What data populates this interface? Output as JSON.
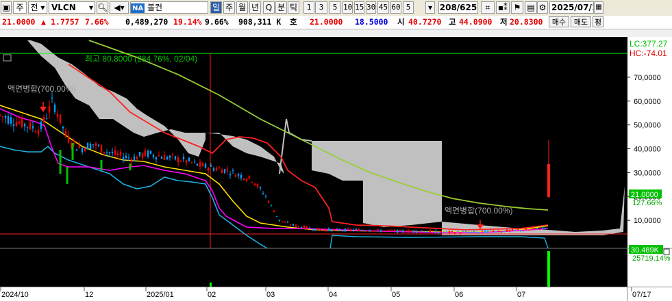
{
  "toolbar": {
    "kind_label": "주",
    "kind2_label": "전",
    "ticker": "VLCN",
    "exchange_badge": "NA",
    "company_name": "볼컨",
    "periods": [
      "일",
      "주",
      "월",
      "년",
      "Q",
      "분",
      "틱"
    ],
    "selected_period": "일",
    "intervals": [
      "1",
      "3",
      "5",
      "10",
      "15",
      "30",
      "45",
      "60",
      "5"
    ],
    "count_display": "208/625",
    "date_value": "2025/07/1"
  },
  "quote": {
    "price": "21.0000",
    "change_arrow": "▲",
    "change": "1.7757",
    "change_pct": "7.66%",
    "volume_partial": "0,489,270",
    "vol_pct": "19.14%",
    "turnover_pct": "9.66%",
    "amount": "908,311 K",
    "ho_label": "호",
    "bid": "21.0000",
    "ask": "18.5000",
    "open_label": "시",
    "open": "40.7270",
    "high_label": "고",
    "high": "44.0900",
    "low_label": "저",
    "low": "20.8300",
    "buy_button": "매수",
    "sell_button": "매도",
    "eval_button": "평"
  },
  "overlay": {
    "lc_label": "LC:377.27",
    "hc_label": "HC:-74.01",
    "high_annotation": "최고 80.8000 (284.76%, 02/04)",
    "split_annotation_1": "액면병합(700.00%)",
    "split_annotation_2": "액면병합(700.00%)",
    "price_tag": "21.0000",
    "price_pct_tag": "127.66%",
    "volume_tag": "30.489K",
    "volume_pct_tag": "25719.14%"
  },
  "colors": {
    "price_tag_bg": "#00c000",
    "candle_up": "#ff0000",
    "candle_down": "#00a0ff",
    "ma_short": "#ff00ff",
    "ma_mid": "#ffff00",
    "ma_long": "#9acd32",
    "envelope": "#ff2020",
    "cloud": "#c0c0c0",
    "volume": "#00ff00"
  },
  "chart_data": {
    "type": "line",
    "title": "",
    "y_ticks": [
      "70,0000",
      "60,0000",
      "50,0000",
      "40,0000",
      "30,0000",
      "20,0000",
      "10,0000"
    ],
    "x_ticks": [
      "2024/10",
      "12",
      "2025/01",
      "02",
      "03",
      "04",
      "05",
      "06",
      "07",
      "07/17"
    ],
    "ylim": [
      0,
      80
    ],
    "grid": false,
    "series": [
      {
        "name": "close",
        "values": [
          54,
          52,
          50,
          48,
          60,
          45,
          40,
          42,
          39,
          37,
          36,
          38,
          37,
          36,
          35,
          33,
          32,
          31,
          29,
          27,
          20,
          10,
          8,
          7,
          6,
          6,
          6,
          6,
          6,
          5.5,
          5.5,
          5.5,
          5.5,
          5,
          5,
          5,
          5,
          5.5,
          5.5,
          6,
          6,
          7,
          21
        ]
      },
      {
        "name": "volume",
        "values": [
          1,
          1,
          1,
          1,
          1,
          1,
          1,
          1,
          1,
          1,
          1,
          1,
          1,
          1,
          1,
          1,
          1,
          1,
          1,
          1,
          4,
          1,
          1,
          1,
          1,
          1,
          1,
          1,
          1,
          1,
          1,
          1,
          1,
          1,
          1,
          1,
          1,
          1,
          1,
          1,
          1,
          1,
          60
        ]
      }
    ]
  }
}
